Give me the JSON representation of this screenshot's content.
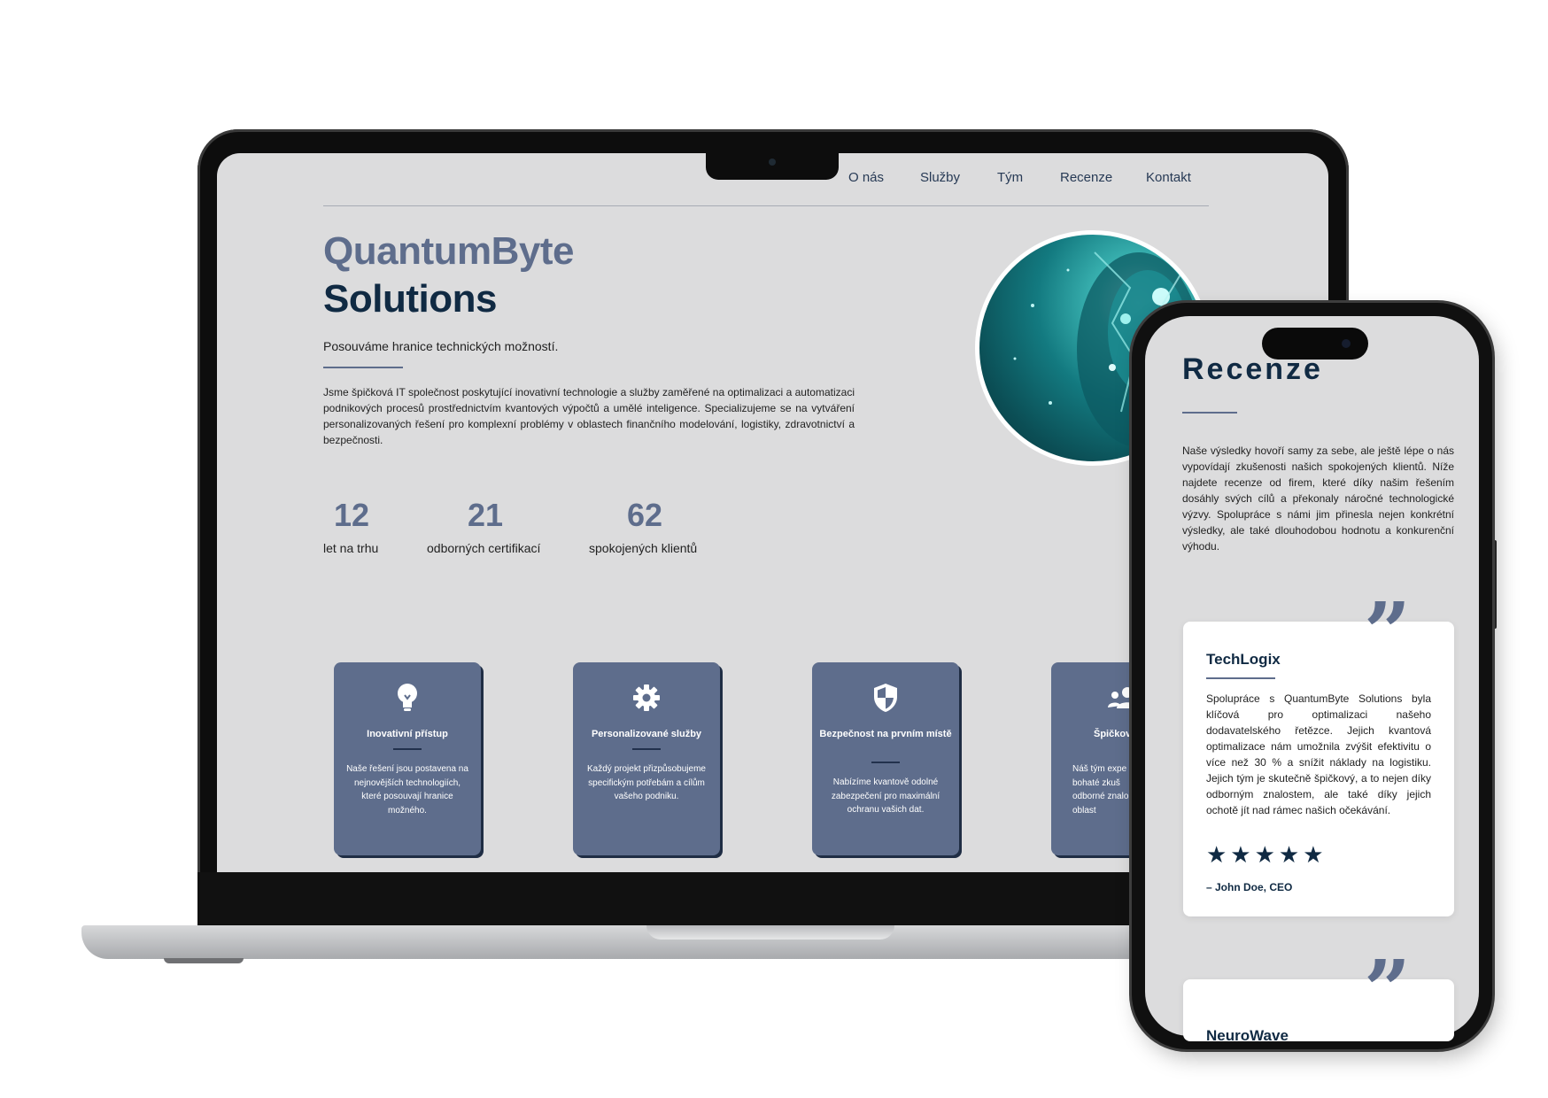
{
  "laptop_site": {
    "nav": [
      "O nás",
      "Služby",
      "Tým",
      "Recenze",
      "Kontakt"
    ],
    "brand_line1": "QuantumByte",
    "brand_line2": "Solutions",
    "tagline": "Posouváme hranice technických možností.",
    "intro": "Jsme špičková IT společnost poskytující inovativní technologie a služby zaměřené na optimalizaci a automatizaci podnikových procesů prostřednictvím kvantových výpočtů a umělé inteligence. Specializujeme se na vytváření personalizovaných řešení pro komplexní problémy v oblastech finančního modelování, logistiky, zdravotnictví a bezpečnosti.",
    "stats": [
      {
        "value": "12",
        "label": "let na trhu"
      },
      {
        "value": "21",
        "label": "odborných certifikací"
      },
      {
        "value": "62",
        "label": "spokojených klientů"
      }
    ],
    "cards": [
      {
        "icon": "lightbulb-icon",
        "title": "Inovativní přístup",
        "text": "Naše řešení jsou postavena na nejnovějších technologiích, které posouvají hranice možného."
      },
      {
        "icon": "gear-icon",
        "title": "Personalizované služby",
        "text": "Každý projekt přizpůsobujeme specifickým potřebám a cílům vašeho podniku."
      },
      {
        "icon": "shield-icon",
        "title": "Bezpečnost na prvním místě",
        "text": "Nabízíme kvantově odolné zabezpečení pro maximální ochranu vašich dat."
      },
      {
        "icon": "team-icon",
        "title": "Špičkový",
        "text": "Náš tým expe bohaté zkuš odborné znalo oblast"
      }
    ]
  },
  "phone_site": {
    "title": "Recenze",
    "intro": "Naše výsledky hovoří samy za sebe, ale ještě lépe o nás vypovídají zkušenosti našich spokojených klientů. Níže najdete recenze od firem, které díky našim řešením dosáhly svých cílů a překonaly náročné technologické výzvy. Spolupráce s námi jim přinesla nejen konkrétní výsledky, ale také dlouhodobou hodnotu a konkurenční výhodu.",
    "reviews": [
      {
        "company": "TechLogix",
        "text": "Spolupráce s QuantumByte Solutions byla klíčová pro optimalizaci našeho dodavatelského řetězce. Jejich kvantová optimalizace nám umožnila zvýšit efektivitu o více než 30 % a snížit náklady na logistiku. Jejich tým je skutečně špičkový, a to nejen díky odborným znalostem, ale také díky jejich ochotě jít nad rámec našich očekávání.",
        "stars": "★★★★★",
        "rating": 5,
        "author": "– John Doe, CEO"
      },
      {
        "company": "NeuroWave"
      }
    ]
  },
  "colors": {
    "accent": "#5e6d8c",
    "navy": "#102a43",
    "screen_bg": "#dcdcdd"
  }
}
